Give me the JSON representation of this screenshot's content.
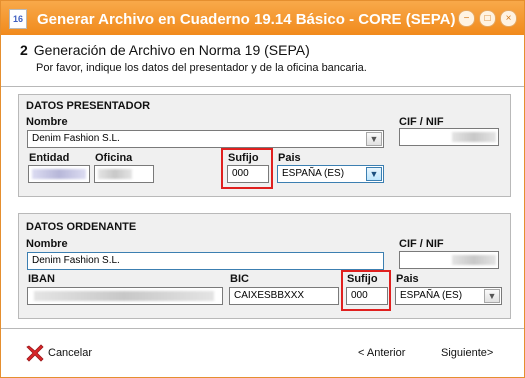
{
  "window": {
    "title": "Generar Archivo en Cuaderno 19.14 Básico - CORE (SEPA)",
    "icon_text": "16"
  },
  "step": {
    "number": "2",
    "title": "Generación de Archivo en Norma 19 (SEPA)",
    "subtitle": "Por favor, indique los datos del presentador y de la oficina bancaria."
  },
  "presentador": {
    "group_title": "DATOS PRESENTADOR",
    "nombre_label": "Nombre",
    "nombre_value": "Denim Fashion S.L.",
    "cif_label": "CIF / NIF",
    "entidad_label": "Entidad",
    "oficina_label": "Oficina",
    "sufijo_label": "Sufijo",
    "sufijo_value": "000",
    "pais_label": "Pais",
    "pais_value": "ESPAÑA  (ES)"
  },
  "ordenante": {
    "group_title": "DATOS ORDENANTE",
    "nombre_label": "Nombre",
    "nombre_value": "Denim Fashion S.L.",
    "cif_label": "CIF / NIF",
    "iban_label": "IBAN",
    "bic_label": "BIC",
    "bic_value": "CAIXESBBXXX",
    "sufijo_label": "Sufijo",
    "sufijo_value": "000",
    "pais_label": "Pais",
    "pais_value": "ESPAÑA  (ES)"
  },
  "footer": {
    "cancel_label": "Cancelar",
    "back_label": "< Anterior",
    "next_label": "Siguiente>"
  },
  "colors": {
    "titlebar": "#f18a1c",
    "highlight": "#e0201f",
    "cancel_icon": "#d9262a"
  }
}
